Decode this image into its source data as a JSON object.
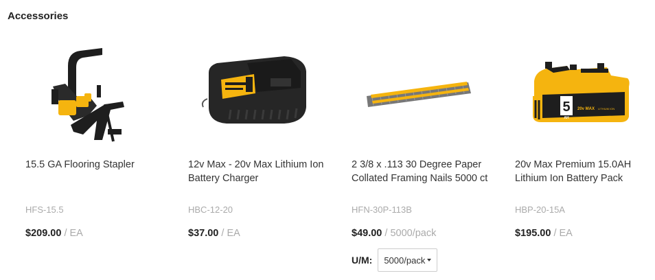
{
  "section": {
    "title": "Accessories"
  },
  "products": [
    {
      "name": "15.5 GA Flooring Stapler",
      "sku": "HFS-15.5",
      "price": "$209.00",
      "unit_sep": "/",
      "unit": "EA",
      "image_icon": "flooring-stapler"
    },
    {
      "name": "12v Max - 20v Max Lithium Ion Battery Charger",
      "sku": "HBC-12-20",
      "price": "$37.00",
      "unit_sep": "/",
      "unit": "EA",
      "image_icon": "battery-charger"
    },
    {
      "name": "2 3/8 x .113 30 Degree Paper Collated Framing Nails 5000 ct",
      "sku": "HFN-30P-113B",
      "price": "$49.00",
      "unit_sep": "/",
      "unit": "5000/pack",
      "image_icon": "framing-nails",
      "uom": {
        "label": "U/M:",
        "selected": "5000/pack"
      }
    },
    {
      "name": "20v Max Premium 15.0AH Lithium Ion Battery Pack",
      "sku": "HBP-20-15A",
      "price": "$195.00",
      "unit_sep": "/",
      "unit": "EA",
      "image_icon": "battery-pack",
      "image_text": {
        "big": "5",
        "small": "AH",
        "band": "20v MAX",
        "band_sub": "LITHIUM ION"
      }
    }
  ],
  "colors": {
    "brand_yellow": "#f5b40f",
    "tool_black": "#1e1e1e",
    "text": "#333333",
    "muted": "#aaaaaa"
  }
}
